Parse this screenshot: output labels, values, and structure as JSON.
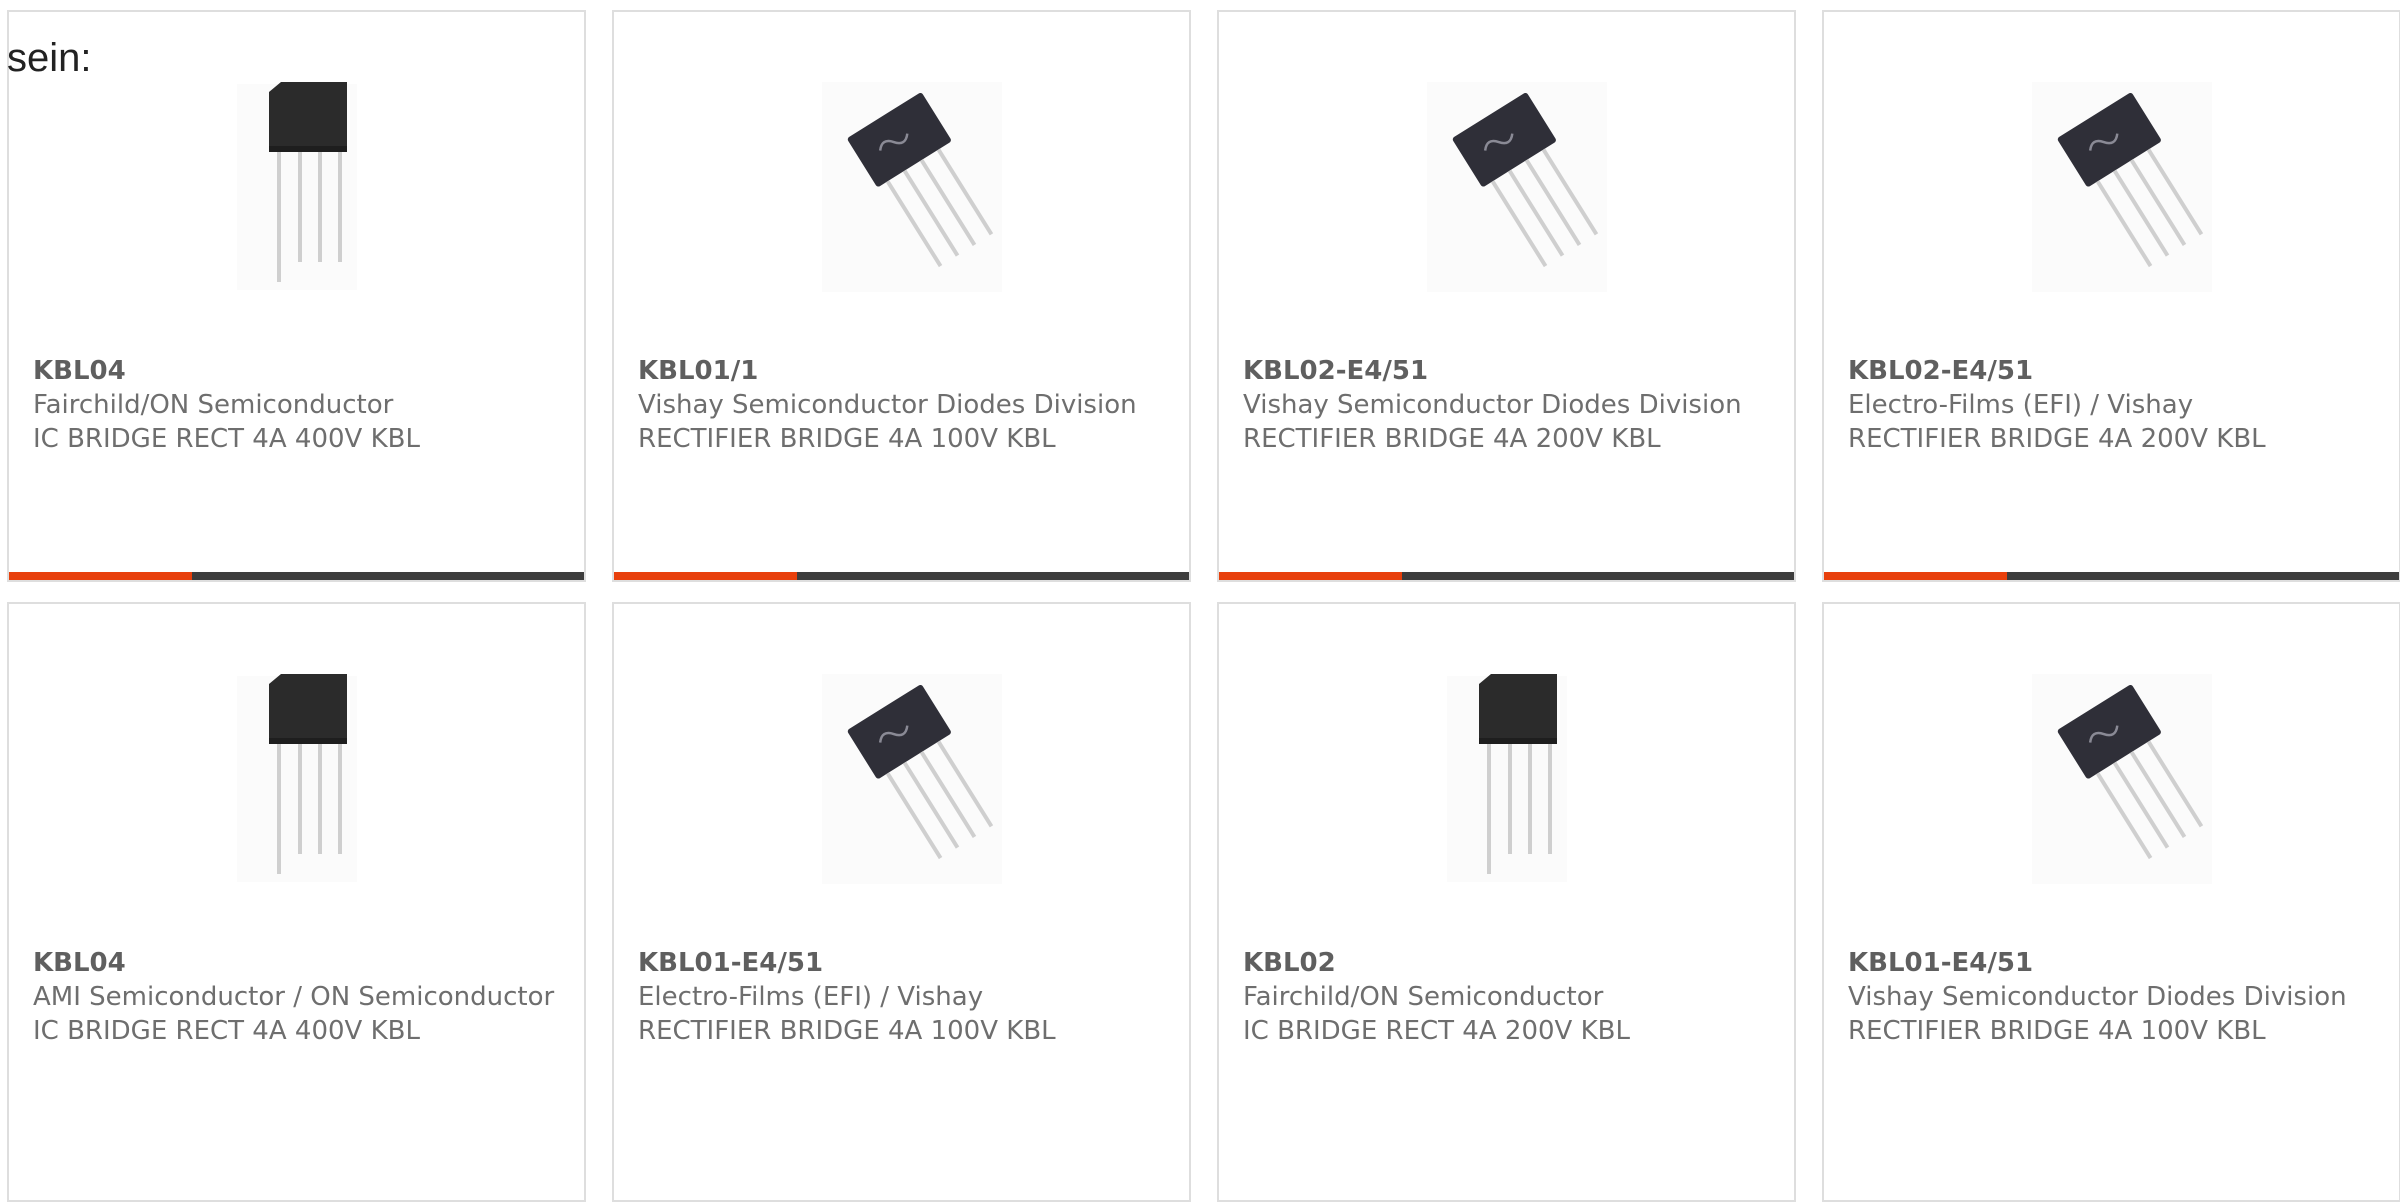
{
  "lead_text": "sein:",
  "colors": {
    "accent": "#e8400c",
    "bar": "#3d3d3d",
    "border": "#dedede",
    "text": "#6e6e6e"
  },
  "products": [
    {
      "part": "KBL04",
      "manufacturer": "Fairchild/ON Semiconductor",
      "description": "IC BRIDGE RECT 4A 400V KBL",
      "image": "kbl-vertical-package-icon",
      "accent_bar": true
    },
    {
      "part": "KBL01/1",
      "manufacturer": "Vishay Semiconductor Diodes Division",
      "description": "RECTIFIER BRIDGE 4A 100V KBL",
      "image": "kbl-tilted-package-icon",
      "accent_bar": true
    },
    {
      "part": "KBL02-E4/51",
      "manufacturer": "Vishay Semiconductor Diodes Division",
      "description": "RECTIFIER BRIDGE 4A 200V KBL",
      "image": "kbl-tilted-package-icon",
      "accent_bar": true
    },
    {
      "part": "KBL02-E4/51",
      "manufacturer": "Electro-Films (EFI) / Vishay",
      "description": "RECTIFIER BRIDGE 4A 200V KBL",
      "image": "kbl-tilted-package-icon",
      "accent_bar": true
    },
    {
      "part": "KBL04",
      "manufacturer": "AMI Semiconductor / ON Semiconductor",
      "description": "IC BRIDGE RECT 4A 400V KBL",
      "image": "kbl-vertical-package-icon",
      "accent_bar": false
    },
    {
      "part": "KBL01-E4/51",
      "manufacturer": "Electro-Films (EFI) / Vishay",
      "description": "RECTIFIER BRIDGE 4A 100V KBL",
      "image": "kbl-tilted-package-icon",
      "accent_bar": false
    },
    {
      "part": "KBL02",
      "manufacturer": "Fairchild/ON Semiconductor",
      "description": "IC BRIDGE RECT 4A 200V KBL",
      "image": "kbl-vertical-package-icon",
      "accent_bar": false
    },
    {
      "part": "KBL01-E4/51",
      "manufacturer": "Vishay Semiconductor Diodes Division",
      "description": "RECTIFIER BRIDGE 4A 100V KBL",
      "image": "kbl-tilted-package-icon",
      "accent_bar": false
    }
  ]
}
